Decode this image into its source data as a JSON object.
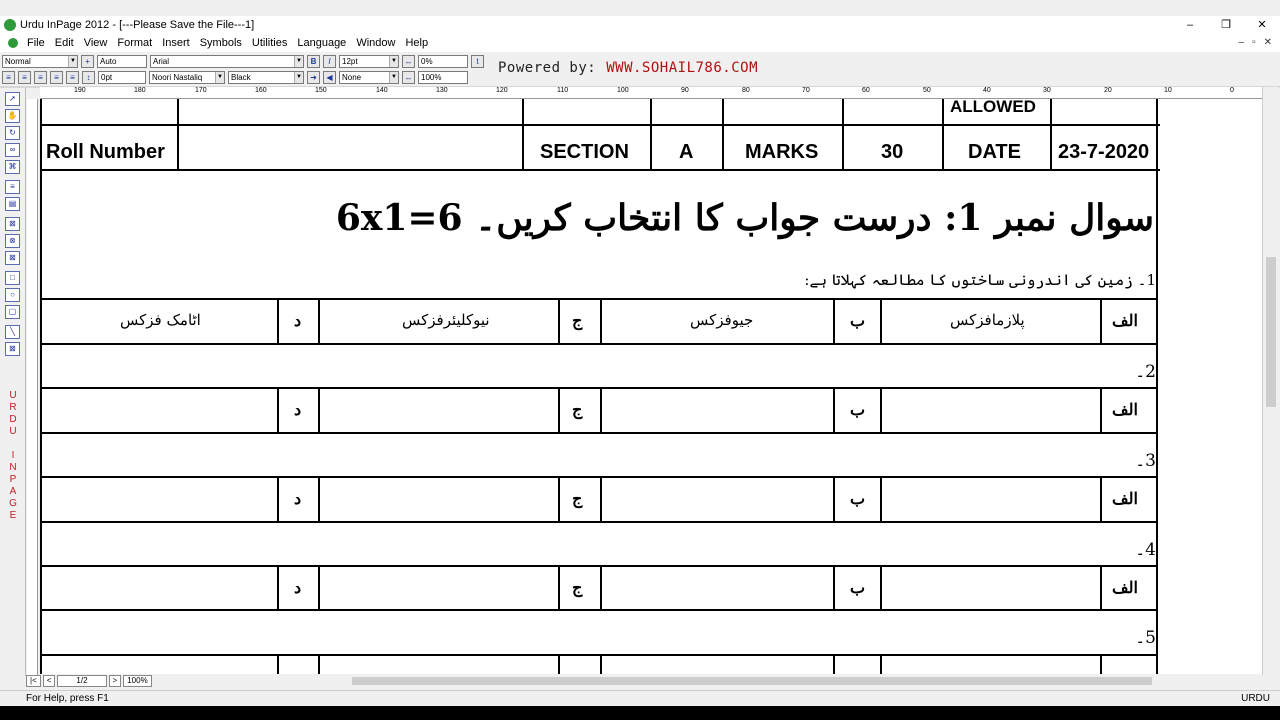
{
  "window": {
    "title": "Urdu InPage 2012 - [---Please Save the File---1]",
    "minimize": "–",
    "restore": "❐",
    "close": "✕"
  },
  "menu": [
    "File",
    "Edit",
    "View",
    "Format",
    "Insert",
    "Symbols",
    "Utilities",
    "Language",
    "Window",
    "Help"
  ],
  "mdi_controls": {
    "minimize": "–",
    "restore": "▫",
    "close": "✕"
  },
  "toolbar": {
    "style": "Normal",
    "leading": "Auto",
    "font_en": "Arial",
    "font_size": "12pt",
    "tracking": "0%",
    "space": "0pt",
    "font_ur": "Noori Nastaliq",
    "color": "Black",
    "shade": "None",
    "scale": "100%",
    "bold": "B",
    "italic": "I"
  },
  "powered": {
    "label": "Powered by:",
    "url": "WWW.SOHAIL786.COM"
  },
  "ruler_labels": [
    "190",
    "180",
    "170",
    "160",
    "150",
    "140",
    "130",
    "120",
    "110",
    "100",
    "90",
    "80",
    "70",
    "60",
    "50",
    "40",
    "30",
    "20",
    "10",
    "0"
  ],
  "side_label": [
    "U",
    "R",
    "D",
    "U",
    "",
    "I",
    "N",
    "P",
    "A",
    "G",
    "E"
  ],
  "doc": {
    "allowed": "ALLOWED",
    "roll_label": "Roll Number",
    "section_label": "SECTION",
    "section_value": "A",
    "marks_label": "MARKS",
    "marks_value": "30",
    "date_label": "DATE",
    "date_value": "23-7-2020",
    "q_heading": "سوال نمبر 1: درست جواب کا انتخاب کریں۔ 6x1=6",
    "q1_text": "1۔ زمین کی اندرونی ساختوں کا مطالعہ کہلاتا ہے:",
    "q_numbers": [
      "2۔",
      "3۔",
      "4۔",
      "5۔"
    ],
    "opt_labels": {
      "a": "الف",
      "b": "ب",
      "c": "ج",
      "d": "د"
    },
    "q1_options": {
      "a": "پلازمافزکس",
      "b": "جیوفزکس",
      "c": "نیوکلیئرفزکس",
      "d": "اٹامک فزکس"
    }
  },
  "nav": {
    "first": "|<",
    "prev": "<",
    "page": "1/2",
    "next": ">",
    "zoom": "100%"
  },
  "status": {
    "help": "For Help, press F1",
    "language": "URDU"
  }
}
